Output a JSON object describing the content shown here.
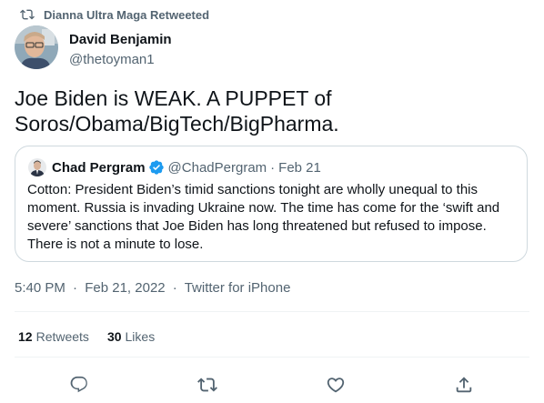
{
  "retweet_context": {
    "text": "Dianna Ultra Maga Retweeted",
    "icon": "retweet-icon"
  },
  "author": {
    "name": "David Benjamin",
    "handle": "@thetoyman1"
  },
  "tweet": {
    "text": "Joe Biden is WEAK. A PUPPET of Soros/Obama/BigTech/BigPharma."
  },
  "quote": {
    "name": "Chad Pergram",
    "handle": "@ChadPergram",
    "separator": "·",
    "date": "Feb 21",
    "verified_icon": "verified-badge-icon",
    "text": "Cotton: President Biden’s timid sanctions tonight are wholly unequal to this moment. Russia is invading Ukraine now. The time has come for the ‘swift and severe’ sanctions that Joe Biden has long threatened but refused to impose. There is not a minute to lose."
  },
  "meta": {
    "time": "5:40 PM",
    "separator": "·",
    "date": "Feb 21, 2022",
    "source": "Twitter for iPhone"
  },
  "stats": {
    "retweets_count": "12",
    "retweets_label": "Retweets",
    "likes_count": "30",
    "likes_label": "Likes"
  },
  "actions": [
    "reply-icon",
    "retweet-icon",
    "like-icon",
    "share-icon"
  ],
  "colors": {
    "text": "#0f1419",
    "secondary": "#536471",
    "border": "#cfd9de",
    "verified": "#1d9bf0"
  }
}
